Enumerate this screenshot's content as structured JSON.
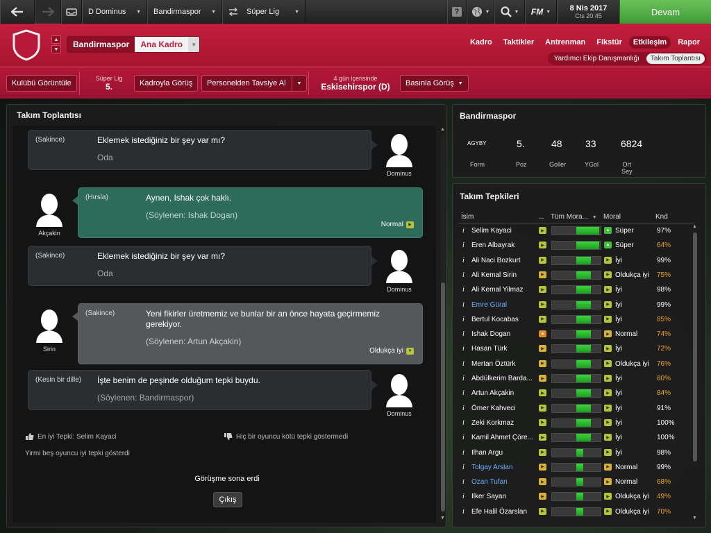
{
  "topbar": {
    "manager": "D Dominus",
    "club": "Bandirmaspor",
    "league": "Süper Lig",
    "help_label": "?",
    "fm_label": "FM",
    "date": "8 Nis 2017",
    "time": "Cts 20:45",
    "continue_label": "Devam"
  },
  "header": {
    "club": "Bandirmaspor",
    "squad_label": "Ana Kadro",
    "nav": [
      "Kadro",
      "Taktikler",
      "Antrenman",
      "Fikstür",
      "Etkileşim",
      "Rapor"
    ],
    "nav_active": "Etkileşim",
    "subnav": [
      "Yardımcı Ekip Danışmanlığı",
      "Takım Toplantısı"
    ],
    "subnav_active": "Takım Toplantısı"
  },
  "actionbar": {
    "view_club": "Kulübü Görüntüle",
    "league_name": "Süper Lig",
    "league_pos": "5.",
    "squad_talk": "Kadroyla Görüş",
    "staff_advice": "Personelden Tavsiye Al",
    "next_match_when": "4 gün içerisinde",
    "next_match": "Eskisehirspor (D)",
    "press_talk": "Basınla Görüş"
  },
  "meeting": {
    "title": "Takım Toplantısı",
    "messages": [
      {
        "tone": "(Sakince)",
        "text": "Eklemek istediğiniz bir şey var mı?",
        "sub": "Oda",
        "speaker": "Dominus"
      },
      {
        "tone": "(Hırsla)",
        "text": "Aynen, Ishak çok haklı.",
        "sub": "(Söylenen: Ishak Dogan)",
        "speaker": "Akçakin",
        "mood": "Normal"
      },
      {
        "tone": "(Sakince)",
        "text": "Eklemek istediğiniz bir şey var mı?",
        "sub": "Oda",
        "speaker": "Dominus"
      },
      {
        "tone": "(Sakince)",
        "text": "Yeni fikirler üretmemiz ve bunlar bir an önce hayata geçirmemiz gerekiyor.",
        "sub": "(Söylenen: Artun Akçakin)",
        "speaker": "Sirin",
        "mood": "Oldukça iyi"
      },
      {
        "tone": "(Kesin bir dille)",
        "text": "İşte benim de peşinde olduğum tepki buydu.",
        "sub": "(Söylenen: Bandirmaspor)",
        "speaker": "Dominus"
      }
    ],
    "best_reaction": "En iyi Tepki: Selim Kayaci",
    "no_bad": "Hiç bir oyuncu kötü tepki göstermedi",
    "summary": "Yirmi beş oyuncu iyi tepki gösterdi",
    "ended": "Görüşme sona erdi",
    "exit_label": "Çıkış"
  },
  "stats": {
    "title": "Bandirmaspor",
    "items": [
      {
        "value": "AGYBY",
        "label": "Form"
      },
      {
        "value": "5.",
        "label": "Poz"
      },
      {
        "value": "48",
        "label": "Goller"
      },
      {
        "value": "33",
        "label": "YGol"
      },
      {
        "value": "6824",
        "label": "Ort Sey"
      }
    ]
  },
  "reactions": {
    "title": "Takım Tepkileri",
    "headers": {
      "name": "İsim",
      "dots": "...",
      "all_morale": "Tüm Mora...",
      "morale": "Moral",
      "knd": "Knd"
    },
    "players": [
      {
        "name": "Selim Kayaci",
        "react": "yg",
        "fill": 0.47,
        "start": 0.5,
        "mind": "g",
        "morale": "Süper",
        "knd": "97%",
        "blue": false,
        "orange": false
      },
      {
        "name": "Eren Albayrak",
        "react": "yg",
        "fill": 0.47,
        "start": 0.5,
        "mind": "g",
        "morale": "Süper",
        "knd": "64%",
        "blue": false,
        "orange": true
      },
      {
        "name": "Ali Naci Bozkurt",
        "react": "yg",
        "fill": 0.3,
        "start": 0.5,
        "mind": "yg",
        "morale": "İyi",
        "knd": "99%",
        "blue": false,
        "orange": false
      },
      {
        "name": "Ali Kemal Sirin",
        "react": "y",
        "fill": 0.3,
        "start": 0.5,
        "mind": "yg",
        "morale": "Oldukça iyi",
        "knd": "75%",
        "blue": false,
        "orange": true
      },
      {
        "name": "Ali Kemal Yilmaz",
        "react": "yg",
        "fill": 0.3,
        "start": 0.5,
        "mind": "yg",
        "morale": "İyi",
        "knd": "98%",
        "blue": false,
        "orange": false
      },
      {
        "name": "Emre Güral",
        "react": "yg",
        "fill": 0.3,
        "start": 0.5,
        "mind": "yg",
        "morale": "İyi",
        "knd": "99%",
        "blue": true,
        "orange": false
      },
      {
        "name": "Bertul Kocabas",
        "react": "yg",
        "fill": 0.3,
        "start": 0.5,
        "mind": "yg",
        "morale": "İyi",
        "knd": "85%",
        "blue": false,
        "orange": true
      },
      {
        "name": "Ishak Dogan",
        "react": "o",
        "fill": 0.3,
        "start": 0.5,
        "mind": "y",
        "morale": "Normal",
        "knd": "74%",
        "blue": false,
        "orange": true
      },
      {
        "name": "Hasan Türk",
        "react": "y",
        "fill": 0.3,
        "start": 0.5,
        "mind": "yg",
        "morale": "İyi",
        "knd": "72%",
        "blue": false,
        "orange": true
      },
      {
        "name": "Mertan Öztürk",
        "react": "y",
        "fill": 0.3,
        "start": 0.5,
        "mind": "yg",
        "morale": "Oldukça iyi",
        "knd": "76%",
        "blue": false,
        "orange": true
      },
      {
        "name": "Abdülkerim Barda...",
        "react": "y",
        "fill": 0.3,
        "start": 0.5,
        "mind": "yg",
        "morale": "İyi",
        "knd": "80%",
        "blue": false,
        "orange": true
      },
      {
        "name": "Artun Akçakin",
        "react": "yg",
        "fill": 0.3,
        "start": 0.5,
        "mind": "yg",
        "morale": "İyi",
        "knd": "84%",
        "blue": false,
        "orange": true
      },
      {
        "name": "Ömer Kahveci",
        "react": "yg",
        "fill": 0.3,
        "start": 0.5,
        "mind": "yg",
        "morale": "İyi",
        "knd": "91%",
        "blue": false,
        "orange": false
      },
      {
        "name": "Zeki Korkmaz",
        "react": "yg",
        "fill": 0.3,
        "start": 0.5,
        "mind": "yg",
        "morale": "İyi",
        "knd": "100%",
        "blue": false,
        "orange": false
      },
      {
        "name": "Kamil Ahmet Çöre...",
        "react": "yg",
        "fill": 0.3,
        "start": 0.5,
        "mind": "yg",
        "morale": "İyi",
        "knd": "100%",
        "blue": false,
        "orange": false
      },
      {
        "name": "Ilhan Argu",
        "react": "yg",
        "fill": 0.14,
        "start": 0.5,
        "mind": "yg",
        "morale": "İyi",
        "knd": "98%",
        "blue": false,
        "orange": false
      },
      {
        "name": "Tolgay Arslan",
        "react": "y",
        "fill": 0.14,
        "start": 0.5,
        "mind": "y",
        "morale": "Normal",
        "knd": "99%",
        "blue": true,
        "orange": false
      },
      {
        "name": "Ozan Tufan",
        "react": "y",
        "fill": 0.14,
        "start": 0.5,
        "mind": "y",
        "morale": "Normal",
        "knd": "68%",
        "blue": true,
        "orange": true
      },
      {
        "name": "Ilker Sayan",
        "react": "y",
        "fill": 0.14,
        "start": 0.5,
        "mind": "yg",
        "morale": "Oldukça iyi",
        "knd": "49%",
        "blue": false,
        "orange": true
      },
      {
        "name": "Efe Halil Özarslan",
        "react": "yg",
        "fill": 0.14,
        "start": 0.5,
        "mind": "yg",
        "morale": "Oldukça iyi",
        "knd": "70%",
        "blue": false,
        "orange": true
      }
    ]
  }
}
